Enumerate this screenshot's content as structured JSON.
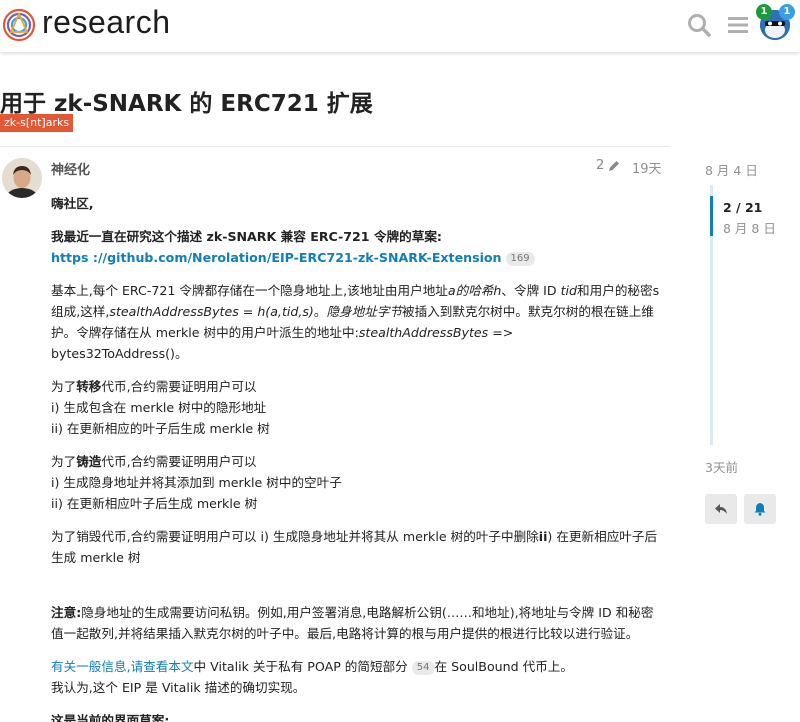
{
  "header": {
    "brand": "research",
    "notifications": {
      "green_count": "1",
      "blue_count": "1"
    },
    "icons": {
      "search": "search-icon",
      "menu": "hamburger-icon",
      "avatar": "user-avatar"
    }
  },
  "topic": {
    "title": "用于 zk-SNARK 的 ERC721 扩展",
    "tag": "zk-s[nt]arks"
  },
  "post": {
    "username": "神经化",
    "edit_count": "2",
    "date": "19天",
    "greeting": "嗨社区,",
    "intro_bold": "我最近一直在研究这个描述 zk-SNARK 兼容 ERC-721 令牌的草案:",
    "github_link": "https ://github.com/Nerolation/EIP-ERC721-zk-SNARK-Extension",
    "github_clicks": "169",
    "p1_a": "基本上,每个 ERC-721 令牌都存储在一个隐身地址上,该地址由用户地址",
    "p1_a_it": "a的哈希h",
    "p1_b": "、令牌 ID ",
    "p1_b_it": "tid",
    "p1_c": "和用户的秘密s组成,这样,",
    "p1_c_it": "stealthAddressBytes = h(a,tid,s)",
    "p1_d": "。",
    "p1_d_it": "隐身地址字节",
    "p1_e": "被插入到默克尔树中。默克尔树的根在链上维护。令牌存储在从 merkle 树中的用户叶派生的地址中:",
    "p1_e_it": "stealthAddressBytes => ",
    "p1_f": "bytes32ToAddress()。",
    "transfer_a": "为了",
    "transfer_b": "转移",
    "transfer_c": "代币,合约需要证明用户可以",
    "transfer_i": "i) 生成包含在 merkle 树中的隐形地址",
    "transfer_ii": "ii) 在更新相应的叶子后生成 merkle 树",
    "mint_a": "为了",
    "mint_b": "铸造",
    "mint_c": "代币,合约需要证明用户可以",
    "mint_i": "i) 生成隐身地址并将其添加到 merkle 树中的空叶子",
    "mint_ii": "ii) 在更新相应叶子后生成 merkle 树",
    "burn_a": "为了销毁代币,合约需要证明用户可以 i) 生成隐身地址并将其从 merkle 树的叶子中删除",
    "burn_b": "ii",
    "burn_c": ") 在更新相应叶子后生成 merkle 树",
    "note_label": "注意:",
    "note_text": "隐身地址的生成需要访问私钥。例如,用户签署消息,电路解析公钥(……和地址),将地址与令牌 ID 和秘密值一起散列,并将结果插入默克尔树的叶子中。最后,电路将计算的根与用户提供的根进行比较以进行验证。",
    "more_link1": "有关一般信息,",
    "more_link2": "请查看本文",
    "more_text_a": "中 Vitalik 关于私有 POAP 的简短部分",
    "more_clicks": "54",
    "more_text_b": "在 SoulBound 代币上。",
    "believe": "我认为,这个 EIP 是 Vitalik 描述的确切实现。",
    "interface": "这是当前的界面草案:"
  },
  "timeline": {
    "top_date": "8 月 4 日",
    "position": "2 / 21",
    "position_date": "8 月 8 日",
    "bottom_date": "3天前"
  }
}
